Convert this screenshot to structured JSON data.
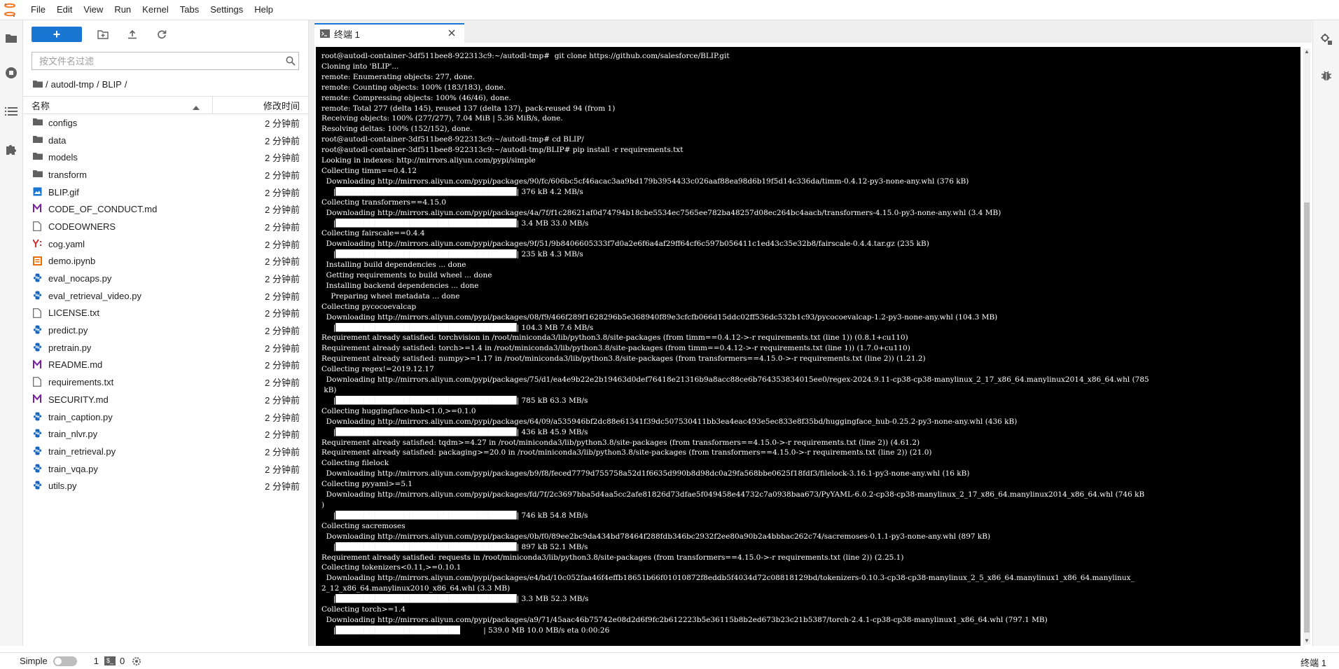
{
  "menu": [
    "File",
    "Edit",
    "View",
    "Run",
    "Kernel",
    "Tabs",
    "Settings",
    "Help"
  ],
  "filebrowser": {
    "new_label": "+",
    "filter_placeholder": "按文件名过滤",
    "breadcrumb": [
      "/",
      "autodl-tmp",
      "/",
      "BLIP",
      "/"
    ],
    "col_name": "名称",
    "col_modified": "修改时间",
    "files": [
      {
        "name": "configs",
        "type": "folder",
        "modified": "2 分钟前"
      },
      {
        "name": "data",
        "type": "folder",
        "modified": "2 分钟前"
      },
      {
        "name": "models",
        "type": "folder",
        "modified": "2 分钟前"
      },
      {
        "name": "transform",
        "type": "folder",
        "modified": "2 分钟前"
      },
      {
        "name": "BLIP.gif",
        "type": "image",
        "modified": "2 分钟前"
      },
      {
        "name": "CODE_OF_CONDUCT.md",
        "type": "markdown",
        "modified": "2 分钟前"
      },
      {
        "name": "CODEOWNERS",
        "type": "file",
        "modified": "2 分钟前"
      },
      {
        "name": "cog.yaml",
        "type": "yaml",
        "modified": "2 分钟前"
      },
      {
        "name": "demo.ipynb",
        "type": "notebook",
        "modified": "2 分钟前"
      },
      {
        "name": "eval_nocaps.py",
        "type": "python",
        "modified": "2 分钟前"
      },
      {
        "name": "eval_retrieval_video.py",
        "type": "python",
        "modified": "2 分钟前"
      },
      {
        "name": "LICENSE.txt",
        "type": "file",
        "modified": "2 分钟前"
      },
      {
        "name": "predict.py",
        "type": "python",
        "modified": "2 分钟前"
      },
      {
        "name": "pretrain.py",
        "type": "python",
        "modified": "2 分钟前"
      },
      {
        "name": "README.md",
        "type": "markdown",
        "modified": "2 分钟前"
      },
      {
        "name": "requirements.txt",
        "type": "file",
        "modified": "2 分钟前"
      },
      {
        "name": "SECURITY.md",
        "type": "markdown",
        "modified": "2 分钟前"
      },
      {
        "name": "train_caption.py",
        "type": "python",
        "modified": "2 分钟前"
      },
      {
        "name": "train_nlvr.py",
        "type": "python",
        "modified": "2 分钟前"
      },
      {
        "name": "train_retrieval.py",
        "type": "python",
        "modified": "2 分钟前"
      },
      {
        "name": "train_vqa.py",
        "type": "python",
        "modified": "2 分钟前"
      },
      {
        "name": "utils.py",
        "type": "python",
        "modified": "2 分钟前"
      }
    ]
  },
  "tab": {
    "label": "终端 1"
  },
  "terminal": {
    "lines": [
      "root@autodl-container-3df511bee8-922313c9:~/autodl-tmp#  git clone https://github.com/salesforce/BLIP.git",
      "Cloning into 'BLIP'...",
      "remote: Enumerating objects: 277, done.",
      "remote: Counting objects: 100% (183/183), done.",
      "remote: Compressing objects: 100% (46/46), done.",
      "remote: Total 277 (delta 145), reused 137 (delta 137), pack-reused 94 (from 1)",
      "Receiving objects: 100% (277/277), 7.04 MiB | 5.36 MiB/s, done.",
      "Resolving deltas: 100% (152/152), done.",
      "root@autodl-container-3df511bee8-922313c9:~/autodl-tmp# cd BLIP/",
      "root@autodl-container-3df511bee8-922313c9:~/autodl-tmp/BLIP# pip install -r requirements.txt",
      "Looking in indexes: http://mirrors.aliyun.com/pypi/simple",
      "Collecting timm==0.4.12",
      "  Downloading http://mirrors.aliyun.com/pypi/packages/90/fc/606bc5cf46acac3aa9bd179b3954433c026aaf88ea98d6b19f5d14c336da/timm-0.4.12-py3-none-any.whl (376 kB)",
      "     |████████████████████████████████| 376 kB 4.2 MB/s",
      "Collecting transformers==4.15.0",
      "  Downloading http://mirrors.aliyun.com/pypi/packages/4a/7f/f1c28621af0d74794b18cbe5534ec7565ee782ba48257d08ec264bc4aacb/transformers-4.15.0-py3-none-any.whl (3.4 MB)",
      "     |████████████████████████████████| 3.4 MB 33.0 MB/s",
      "Collecting fairscale==0.4.4",
      "  Downloading http://mirrors.aliyun.com/pypi/packages/9f/51/9b8406605333f7d0a2e6f6a4af29ff64cf6c597b056411c1ed43c35e32b8/fairscale-0.4.4.tar.gz (235 kB)",
      "     |████████████████████████████████| 235 kB 4.3 MB/s",
      "  Installing build dependencies ... done",
      "  Getting requirements to build wheel ... done",
      "  Installing backend dependencies ... done",
      "    Preparing wheel metadata ... done",
      "Collecting pycocoevalcap",
      "  Downloading http://mirrors.aliyun.com/pypi/packages/08/f9/466f289f1628296b5e368940f89e3cfcfb066d15ddc02ff536dc532b1c93/pycocoevalcap-1.2-py3-none-any.whl (104.3 MB)",
      "     |████████████████████████████████| 104.3 MB 7.6 MB/s",
      "Requirement already satisfied: torchvision in /root/miniconda3/lib/python3.8/site-packages (from timm==0.4.12->-r requirements.txt (line 1)) (0.8.1+cu110)",
      "Requirement already satisfied: torch>=1.4 in /root/miniconda3/lib/python3.8/site-packages (from timm==0.4.12->-r requirements.txt (line 1)) (1.7.0+cu110)",
      "Requirement already satisfied: numpy>=1.17 in /root/miniconda3/lib/python3.8/site-packages (from transformers==4.15.0->-r requirements.txt (line 2)) (1.21.2)",
      "Collecting regex!=2019.12.17",
      "  Downloading http://mirrors.aliyun.com/pypi/packages/75/d1/ea4e9b22e2b19463d0def76418e21316b9a8acc88ce6b764353834015ee0/regex-2024.9.11-cp38-cp38-manylinux_2_17_x86_64.manylinux2014_x86_64.whl (785",
      " kB)",
      "     |████████████████████████████████| 785 kB 63.3 MB/s",
      "Collecting huggingface-hub<1.0,>=0.1.0",
      "  Downloading http://mirrors.aliyun.com/pypi/packages/64/09/a535946bf2dc88e61341f39dc507530411bb3ea4eac493e5ec833e8f35bd/huggingface_hub-0.25.2-py3-none-any.whl (436 kB)",
      "     |████████████████████████████████| 436 kB 45.9 MB/s",
      "Requirement already satisfied: tqdm>=4.27 in /root/miniconda3/lib/python3.8/site-packages (from transformers==4.15.0->-r requirements.txt (line 2)) (4.61.2)",
      "Requirement already satisfied: packaging>=20.0 in /root/miniconda3/lib/python3.8/site-packages (from transformers==4.15.0->-r requirements.txt (line 2)) (21.0)",
      "Collecting filelock",
      "  Downloading http://mirrors.aliyun.com/pypi/packages/b9/f8/feced7779d755758a52d1f6635d990b8d98dc0a29fa568bbe0625f18fdf3/filelock-3.16.1-py3-none-any.whl (16 kB)",
      "Collecting pyyaml>=5.1",
      "  Downloading http://mirrors.aliyun.com/pypi/packages/fd/7f/2c3697bba5d4aa5cc2afe81826d73dfae5f049458e44732c7a0938baa673/PyYAML-6.0.2-cp38-cp38-manylinux_2_17_x86_64.manylinux2014_x86_64.whl (746 kB",
      ")",
      "     |████████████████████████████████| 746 kB 54.8 MB/s",
      "Collecting sacremoses",
      "  Downloading http://mirrors.aliyun.com/pypi/packages/0b/f0/89ee2bc9da434bd78464f288fdb346bc2932f2ee80a90b2a4bbbac262c74/sacremoses-0.1.1-py3-none-any.whl (897 kB)",
      "     |████████████████████████████████| 897 kB 52.1 MB/s",
      "Requirement already satisfied: requests in /root/miniconda3/lib/python3.8/site-packages (from transformers==4.15.0->-r requirements.txt (line 2)) (2.25.1)",
      "Collecting tokenizers<0.11,>=0.10.1",
      "  Downloading http://mirrors.aliyun.com/pypi/packages/e4/bd/10c052faa46f4effb18651b66f01010872f8eddb5f4034d72c08818129bd/tokenizers-0.10.3-cp38-cp38-manylinux_2_5_x86_64.manylinux1_x86_64.manylinux_",
      "2_12_x86_64.manylinux2010_x86_64.whl (3.3 MB)",
      "     |████████████████████████████████| 3.3 MB 52.3 MB/s",
      "Collecting torch>=1.4",
      "  Downloading http://mirrors.aliyun.com/pypi/packages/a9/71/45aac46b75742e08d2d6f9fc2b612223b5e36115b8b2ed673b23c21b5387/torch-2.4.1-cp38-cp38-manylinux1_x86_64.whl (797.1 MB)",
      "     |██████████████████████          | 539.0 MB 10.0 MB/s eta 0:00:26"
    ]
  },
  "statusbar": {
    "simple_label": "Simple",
    "kernels": "1",
    "terminal_icon_text": "$_",
    "terminals": "0",
    "right_label": "终端 1"
  }
}
